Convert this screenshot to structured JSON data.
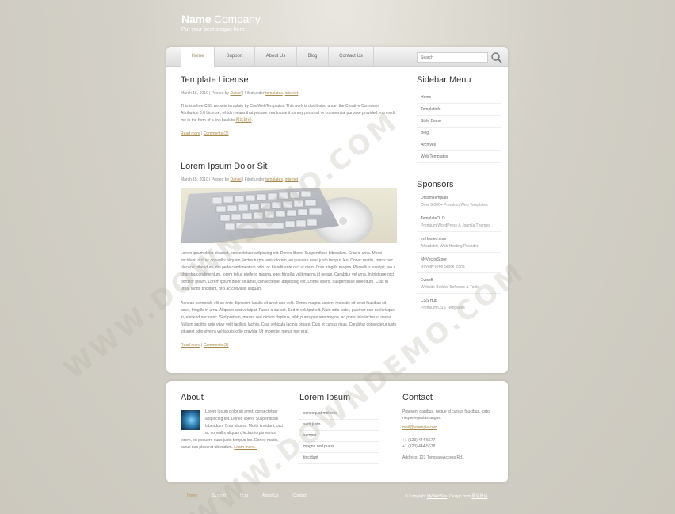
{
  "header": {
    "logo_bold": "Name",
    "logo_light": " Company",
    "slogan": "Put your best slogan here"
  },
  "nav": {
    "tabs": [
      "Home",
      "Support",
      "About Us",
      "Blog",
      "Contact Us"
    ],
    "active": "Home",
    "search_placeholder": "Search"
  },
  "posts": [
    {
      "title": "Template License",
      "date": "March 15, 2010",
      "posted_by_prefix": "Posted by",
      "author": "Daniel",
      "filed_prefix": "Filed under",
      "tag1": "templates",
      "tag2": "internet",
      "body": "This is a free CSS website template by CoolWebTemplates. This work is distributed under the Creative Commons Attribution 3.0 License, which means that you are free to use it for any personal or commercial purpose provided you credit me in the form of a link back to",
      "body_link": "网站建设",
      "read_more": "Read more",
      "comments": "Comments (3)"
    },
    {
      "title": "Lorem Ipsum Dolor Sit",
      "date": "March 15, 2010",
      "posted_by_prefix": "Posted by",
      "author": "Daniel",
      "filed_prefix": "Filed under",
      "tag1": "templates",
      "tag2": "internet",
      "body1": "Lorem ipsum dolor sit amet, consectetuer adipiscing elit. Donec libero. Suspendisse bibendum. Cras id urna. Morbi tincidunt, orci ac convallis aliquam, lectus turpis varius lorem, eu posuere nunc justo tempus leo. Donec mattis, purus nec placerat bibendum, dui pede condimentum odio, ac blandit ante orci ut diam. Cras fringilla magna. Phasellus suscipit, leo a pharetra condimentum, lorem tellus eleifend magna, eget fringilla velit magna id neque. Curabitur vel urna. In tristique orci porttitor ipsum. Lorem ipsum dolor sit amet, consectetuer adipiscing elit. Donec libero. Suspendisse bibendum. Cras id urna. Morbi tincidunt, orci ac convallis aliquam.",
      "body2": "Aenean commodo elit ac ante dignissim iaculis sit amet non velit. Donec magna sapien, molestie sit amet faucibus sit amet, fringilla in urna. Aliquam erat volutpat. Fusce a dui est. Sed in volutpat elit. Nam odio tortor, pulvinar non scelerisque in, eleifend nec nunc. Sed pretium, massa sed dictum dapibus, nibh purus posuere magna, ac porta felis lectus ut neque. Nullam sagittis ante vitae velit facilisis lacinia. Cras vehicula lacinia ornare. Duis et cursus risus. Curabitur consectetur justo sit amet odio viverra vel iaculis odio gravida. Ut imperdiet metus nec erat.",
      "read_more": "Read more",
      "comments": "Comments (3)"
    }
  ],
  "sidebar": {
    "menu_title": "Sidebar Menu",
    "menu": [
      "Home",
      "Templatinfo",
      "Style Demo",
      "Blog",
      "Archives",
      "Web Templates"
    ],
    "sponsors_title": "Sponsors",
    "sponsors": [
      {
        "name": "DreamTemplate",
        "desc": "Over 6,000+ Premium Web Templates"
      },
      {
        "name": "TemplateOLD",
        "desc": "Premium WordPress & Joomla Themes"
      },
      {
        "name": "ImHosted.com",
        "desc": "Affordable Web Hosting Provider"
      },
      {
        "name": "MyVectorStore",
        "desc": "Royalty Free Stock Icons"
      },
      {
        "name": "Evrsoft",
        "desc": "Website Builder Software & Tools"
      },
      {
        "name": "CSS Hub",
        "desc": "Premium CSS Templates"
      }
    ]
  },
  "footer": {
    "about_title": "About",
    "about_text": "Lorem ipsum dolor sit amet, consectetuer adipiscing elit. Donec libero. Suspendisse bibendum. Cras id urna. Morbi tincidunt, orci ac convallis aliquam, lectus turpis varius lorem, eu posuere nunc justo tempus leo. Donec mattis, purus nec placerat bibendum.",
    "about_link": "Learn more...",
    "lorem_title": "Lorem Ipsum",
    "lorem_list": [
      "consequat molestie",
      "sem justo",
      "semper",
      "magna sed purus",
      "tincidunt"
    ],
    "contact_title": "Contact",
    "contact_text": "Praesent dapibus, neque id cursus faucibus, tortor neque egestas augue.",
    "email": "mail@example.com",
    "phone1": "+1 (123) 444-5677",
    "phone2": "+1 (123) 444-5678",
    "address": "Address: 123 TemplateAccess Rd1"
  },
  "bottom": {
    "nav": [
      "Home",
      "Support",
      "Blog",
      "About Us",
      "Contact"
    ],
    "copyright_prefix": "© Copyright",
    "copyright_link": "MyWebSite",
    "copyright_mid": ". Design from",
    "copyright_link2": "网站建设"
  },
  "watermark": "WWW.DOWNDEMO.COM"
}
